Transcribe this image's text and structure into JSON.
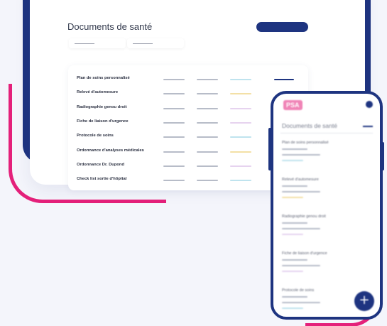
{
  "desktop": {
    "title": "Documents de santé",
    "documents": [
      {
        "label": "Plan de soins personnalisé",
        "accent": "#bfe3ee"
      },
      {
        "label": "Relevé d'automesure",
        "accent": "#f3e0a6"
      },
      {
        "label": "Radiographie genou droit",
        "accent": "#e6d3ef"
      },
      {
        "label": "Fiche de liaison d'urgence",
        "accent": "#e6d3ef"
      },
      {
        "label": "Protocole de soins",
        "accent": "#bfe3ee"
      },
      {
        "label": "Ordonnance d'analyses médicales",
        "accent": "#f3e0a6"
      },
      {
        "label": "Ordonnance Dr. Dupond",
        "accent": "#e6d3ef"
      },
      {
        "label": "Check list sortie d'hôpital",
        "accent": "#bfe3ee"
      }
    ]
  },
  "mobile": {
    "logo": "PSA",
    "title": "Documents de santé",
    "documents": [
      {
        "label": "Plan de soins personnalisé",
        "accent": "#bfe3ee"
      },
      {
        "label": "Relevé d'automesure",
        "accent": "#f3e0a6"
      },
      {
        "label": "Radiographie genou droit",
        "accent": "#e6d3ef"
      },
      {
        "label": "Fiche de liaison d'urgence",
        "accent": "#e6d3ef"
      },
      {
        "label": "Protocole de soins",
        "accent": "#bfe3ee"
      }
    ],
    "fab_icon": "plus-icon",
    "fab_glyph": "+"
  },
  "colors": {
    "navy": "#1e3480",
    "magenta": "#e4207a",
    "background": "#f4f5fb"
  }
}
